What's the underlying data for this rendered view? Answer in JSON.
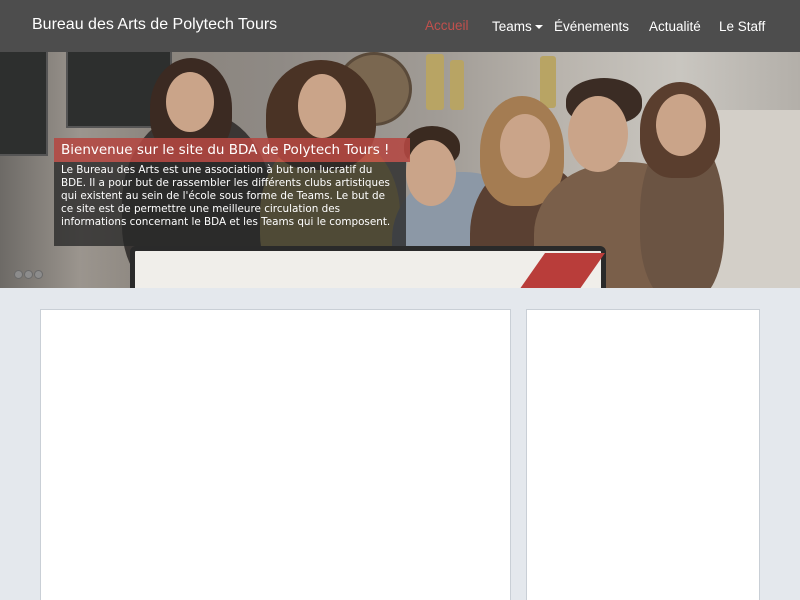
{
  "navbar": {
    "brand": "Bureau des Arts de Polytech Tours",
    "items": [
      {
        "label": "Accueil",
        "active": true
      },
      {
        "label": "Teams",
        "dropdown": true
      },
      {
        "label": "Événements"
      },
      {
        "label": "Actualité"
      },
      {
        "label": "Le Staff"
      }
    ]
  },
  "hero": {
    "caption_title": "Bienvenue sur le site du BDA de Polytech Tours !",
    "caption_text": "Le Bureau des Arts est une association à but non lucratif du BDE. Il a pour but de rassembler les différents clubs artistiques qui existent au sein de l'école sous forme de Teams. Le but de ce site est de permettre une meilleure circulation des informations concernant le BDA et les Teams qui le composent.",
    "slide_count": 3
  },
  "colors": {
    "navbar_bg": "#4d4d4d",
    "accent": "#c0504d",
    "page_bg": "#e4e8ed"
  }
}
